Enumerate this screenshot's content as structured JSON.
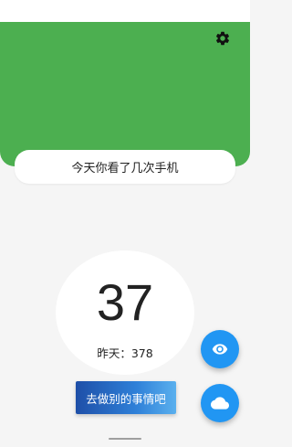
{
  "header": {
    "color": "#4caf50",
    "settings_icon": "gear-icon"
  },
  "headline": {
    "text": "今天你看了几次手机"
  },
  "counter": {
    "today": "37",
    "yesterday_label": "昨天：378"
  },
  "action": {
    "label": "去做别的事情吧"
  },
  "fabs": {
    "color": "#2196f3",
    "primary_icon": "eye-icon",
    "secondary_icon": "cloud-icon"
  }
}
